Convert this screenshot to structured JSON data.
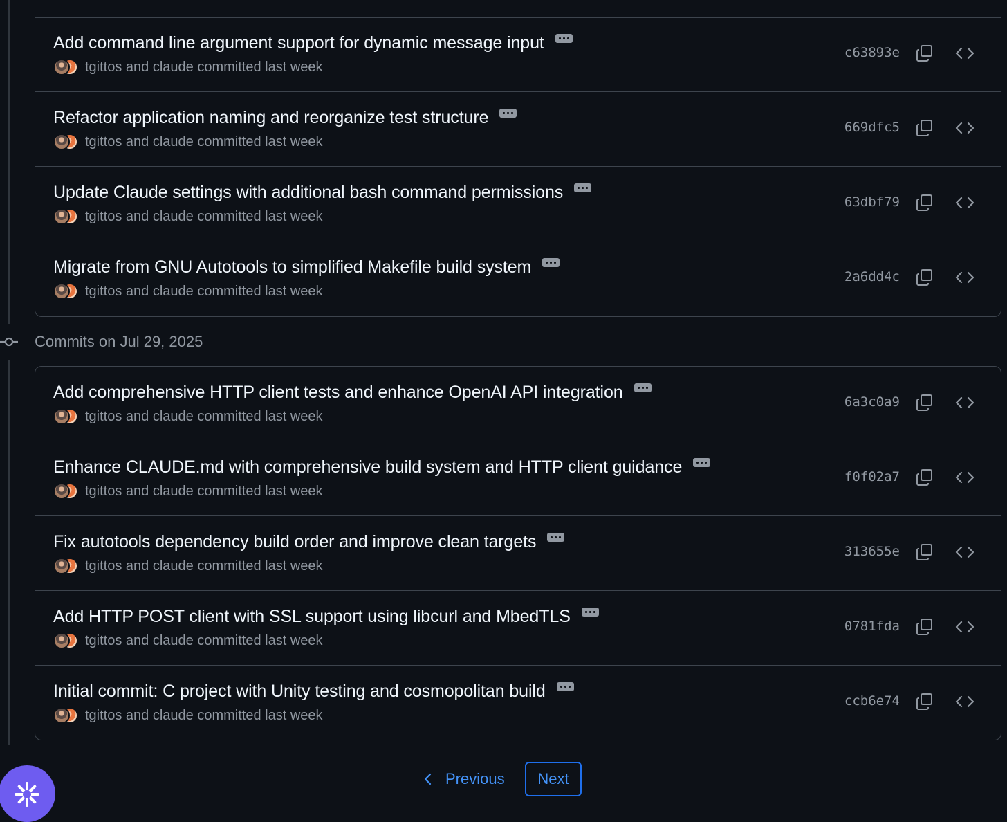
{
  "groups_above": {
    "commits": [
      {
        "title": "Add command line argument support for dynamic message input",
        "meta": "tgittos and claude committed last week",
        "sha": "c63893e"
      },
      {
        "title": "Refactor application naming and reorganize test structure",
        "meta": "tgittos and claude committed last week",
        "sha": "669dfc5"
      },
      {
        "title": "Update Claude settings with additional bash command permissions",
        "meta": "tgittos and claude committed last week",
        "sha": "63dbf79"
      },
      {
        "title": "Migrate from GNU Autotools to simplified Makefile build system",
        "meta": "tgittos and claude committed last week",
        "sha": "2a6dd4c"
      }
    ]
  },
  "group_jul29": {
    "header": "Commits on Jul 29, 2025",
    "commits": [
      {
        "title": "Add comprehensive HTTP client tests and enhance OpenAI API integration",
        "meta": "tgittos and claude committed last week",
        "sha": "6a3c0a9"
      },
      {
        "title": "Enhance CLAUDE.md with comprehensive build system and HTTP client guidance",
        "meta": "tgittos and claude committed last week",
        "sha": "f0f02a7"
      },
      {
        "title": "Fix autotools dependency build order and improve clean targets",
        "meta": "tgittos and claude committed last week",
        "sha": "313655e"
      },
      {
        "title": "Add HTTP POST client with SSL support using libcurl and MbedTLS",
        "meta": "tgittos and claude committed last week",
        "sha": "0781fda"
      },
      {
        "title": "Initial commit: C project with Unity testing and cosmopolitan build",
        "meta": "tgittos and claude committed last week",
        "sha": "ccb6e74"
      }
    ]
  },
  "pagination": {
    "previous": "Previous",
    "next": "Next"
  },
  "icons": {
    "copy": "copy-icon",
    "browse": "code-icon",
    "ellipsis": "ellipsis-icon",
    "commit": "git-commit-icon",
    "fab": "sparkle-icon"
  },
  "colors": {
    "background": "#0d1117",
    "border": "#3d444d",
    "muted": "#9198a1",
    "link": "#4493f8",
    "fab": "#6e5cf0"
  }
}
